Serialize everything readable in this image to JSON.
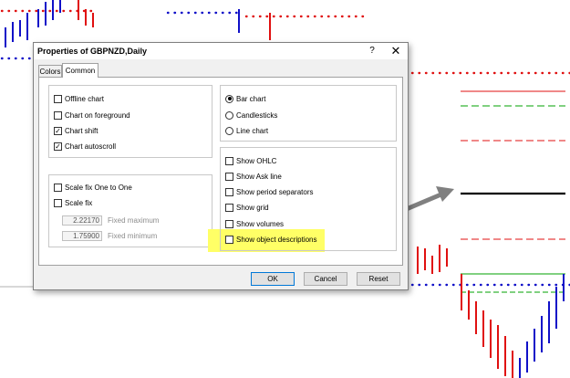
{
  "dialog": {
    "title": "Properties of GBPNZD,Daily",
    "help_glyph": "?",
    "close_glyph": "✕",
    "tabs": [
      {
        "label": "Colors",
        "active": false
      },
      {
        "label": "Common",
        "active": true
      }
    ],
    "options_left": [
      {
        "label": "Offline chart",
        "checked": false
      },
      {
        "label": "Chart on foreground",
        "checked": false
      },
      {
        "label": "Chart shift",
        "checked": true
      },
      {
        "label": "Chart autoscroll",
        "checked": true
      }
    ],
    "scale": [
      {
        "label": "Scale fix One to One",
        "checked": false
      },
      {
        "label": "Scale fix",
        "checked": false
      }
    ],
    "fixed_max": {
      "value": "2.22170",
      "label": "Fixed maximum"
    },
    "fixed_min": {
      "value": "1.75900",
      "label": "Fixed minimum"
    },
    "chart_type": [
      {
        "label": "Bar chart",
        "selected": true
      },
      {
        "label": "Candlesticks",
        "selected": false
      },
      {
        "label": "Line chart",
        "selected": false
      }
    ],
    "show_options": [
      {
        "label": "Show OHLC",
        "checked": false
      },
      {
        "label": "Show Ask line",
        "checked": false
      },
      {
        "label": "Show period separators",
        "checked": false
      },
      {
        "label": "Show grid",
        "checked": false
      },
      {
        "label": "Show volumes",
        "checked": false
      },
      {
        "label": "Show object descriptions",
        "checked": false
      }
    ],
    "buttons": {
      "ok": "OK",
      "cancel": "Cancel",
      "reset": "Reset"
    }
  },
  "colors": {
    "highlight": "#ffff66",
    "arrow": "#808080",
    "bull_bar": "#1010c8",
    "bear_bar": "#e01010",
    "dialog_bg": "#f0f0f0"
  },
  "icons": {
    "check": "✓",
    "annotation_arrow": "arrow-icon"
  }
}
